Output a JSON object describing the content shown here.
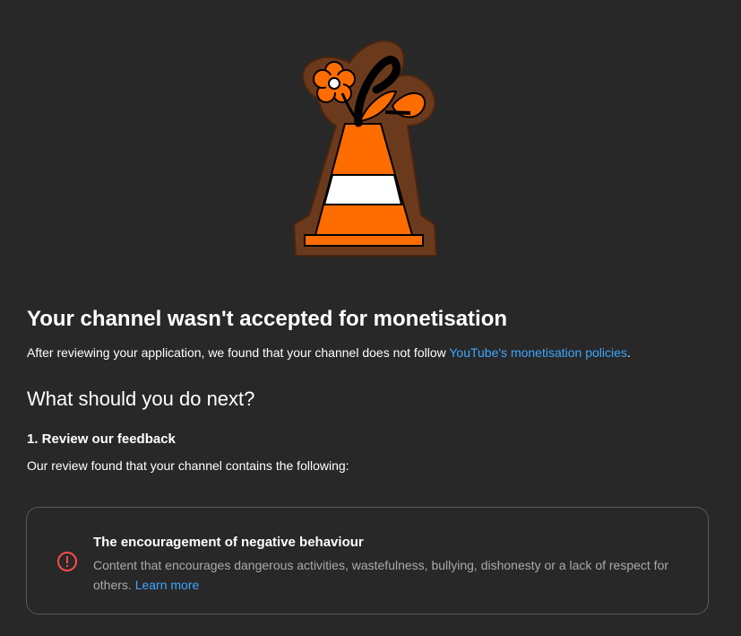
{
  "illustration": {
    "icon": "traffic-cone-with-flowers",
    "colors": {
      "outline": "#6b3a1d",
      "cone": "#ff6d00",
      "stripe": "#ffffff",
      "stroke": "#000000"
    }
  },
  "page": {
    "title": "Your channel wasn't accepted for monetisation",
    "intro_text": "After reviewing your application, we found that your channel does not follow ",
    "intro_link": "YouTube's monetisation policies",
    "intro_end": ".",
    "next_heading": "What should you do next?"
  },
  "step": {
    "title": "1. Review our feedback",
    "description": "Our review found that your channel contains the following:"
  },
  "feedback": {
    "icon": "error-circle-icon",
    "icon_color": "#ff4e45",
    "title": "The encouragement of negative behaviour",
    "description": "Content that encourages dangerous activities, wastefulness, bullying, dishonesty or a lack of respect for others. ",
    "learn_more": "Learn more"
  },
  "colors": {
    "background": "#282828",
    "link": "#3ea6ff",
    "secondary_text": "#aaaaaa",
    "card_border": "#5a5a5a"
  }
}
